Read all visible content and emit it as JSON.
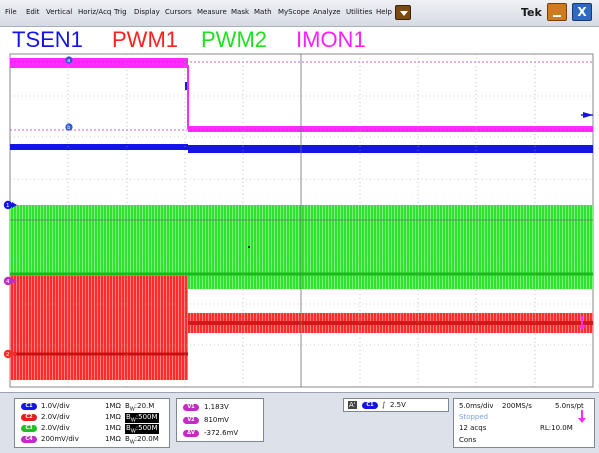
{
  "menu": {
    "items": [
      "File",
      "Edit",
      "Vertical",
      "Horiz/Acq",
      "Trig",
      "Display",
      "Cursors",
      "Measure",
      "Mask",
      "Math",
      "MyScope",
      "Analyze",
      "Utilities",
      "Help"
    ],
    "brand": "Tek",
    "close_label": "X"
  },
  "channel_titles": [
    {
      "label": "TSEN1",
      "color": "#1414e6"
    },
    {
      "label": "PWM1",
      "color": "#ff2020"
    },
    {
      "label": "PWM2",
      "color": "#20e020"
    },
    {
      "label": "IMON1",
      "color": "#ff20ff"
    }
  ],
  "markers": {
    "cursor_a": "a",
    "cursor_b": "b",
    "ch1": "1",
    "ch2": "2",
    "ch4": "4"
  },
  "colors": {
    "ch1": "#1414e6",
    "ch2": "#ff2020",
    "ch3": "#20e020",
    "ch4": "#ff20ff",
    "cursor": "#1a3cd8"
  },
  "channels": [
    {
      "tag": "C1",
      "scale": "1.0V/div",
      "imp": "1MΩ",
      "bw_prefix": "B",
      "bw_sub": "W",
      "bw": ":20.M",
      "bw_boxed": false
    },
    {
      "tag": "C2",
      "scale": "2.0V/div",
      "imp": "1MΩ",
      "bw_prefix": "B",
      "bw_sub": "W",
      "bw": ":500M",
      "bw_boxed": true
    },
    {
      "tag": "C3",
      "scale": "2.0V/div",
      "imp": "1MΩ",
      "bw_prefix": "B",
      "bw_sub": "W",
      "bw": ":500M",
      "bw_boxed": true
    },
    {
      "tag": "C4",
      "scale": "200mV/div",
      "imp": "1MΩ",
      "bw_prefix": "B",
      "bw_sub": "W",
      "bw": ":20.0M",
      "bw_boxed": false
    }
  ],
  "cursors": [
    {
      "tag": "V1",
      "value": "1.183V"
    },
    {
      "tag": "V2",
      "value": "810mV"
    },
    {
      "tag": "ΔV",
      "value": "-372.6mV"
    }
  ],
  "trigger": {
    "tag_a": "A'",
    "tag_ch": "C1",
    "slope": "∫",
    "level": "2.5V"
  },
  "acquisition": {
    "timebase": "5.0ms/div",
    "sample_rate": "200MS/s",
    "per_point": "5.0ns/pt",
    "status": "Stopped",
    "acqs": "12 acqs",
    "record_length": "RL:10.0M",
    "mode": "Cons"
  }
}
